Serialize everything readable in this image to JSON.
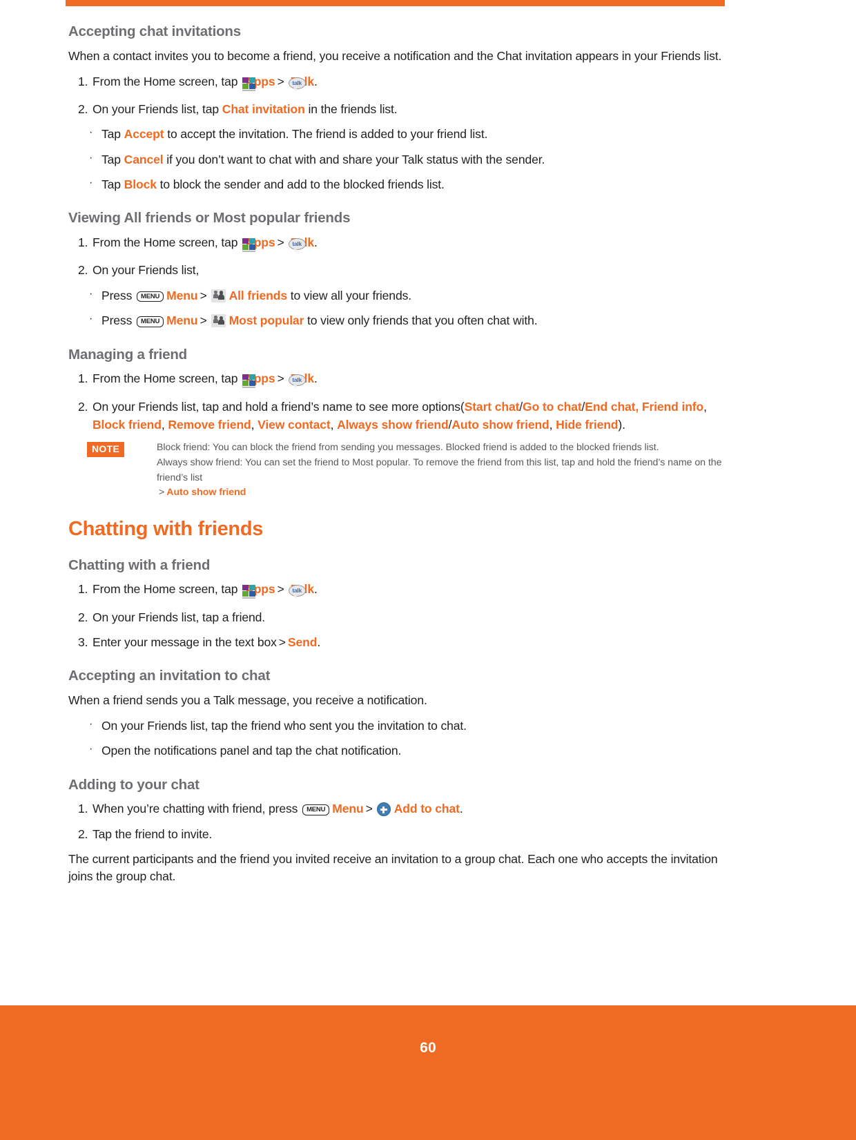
{
  "page": {
    "number": "60",
    "accent_color": "#ef6a22",
    "heading_gray": "#6d6e71",
    "body_black": "#231f20"
  },
  "icons": {
    "apps": "apps-grid-icon",
    "talk": "talk-bubble-icon",
    "talk_label": "talk",
    "menu": "menu-key-icon",
    "menu_label": "MENU",
    "friends": "friends-people-icon",
    "add": "add-to-chat-icon"
  },
  "sections": {
    "accepting_chat_invitations": {
      "title": "Accepting chat invitations",
      "intro": "When a contact invites you to become a friend, you receive a notification and the Chat invitation appears in your Friends list.",
      "step1": {
        "num": "1.",
        "pre": "From the Home screen, tap",
        "apps": "Apps",
        "sep": ">",
        "talk": "Talk",
        "end": "."
      },
      "step2": {
        "num": "2.",
        "pre": "On your Friends list, tap",
        "link": "Chat invitation",
        "post": "in the friends list."
      },
      "bullets": [
        {
          "pre": "Tap",
          "link": "Accept",
          "post": "to accept the invitation. The friend is added to your friend list."
        },
        {
          "pre": "Tap",
          "link": "Cancel",
          "post": "if you don’t want to chat with and share your Talk status with the sender."
        },
        {
          "pre": "Tap",
          "link": "Block",
          "post": "to block the sender and add to the blocked friends list."
        }
      ]
    },
    "viewing_friends": {
      "title": "Viewing All friends or Most popular friends",
      "step1": {
        "num": "1.",
        "pre": "From the Home screen, tap",
        "apps": "Apps",
        "sep": ">",
        "talk": "Talk",
        "end": "."
      },
      "step2": {
        "num": "2.",
        "text": "On your Friends list,"
      },
      "bullets": [
        {
          "pre": "Press",
          "menu": "Menu",
          "sep": ">",
          "link": "All friends",
          "post": "to view all your friends."
        },
        {
          "pre": "Press",
          "menu": "Menu",
          "sep": ">",
          "link": "Most popular",
          "post": "to view only friends that you often chat with."
        }
      ]
    },
    "managing_a_friend": {
      "title": "Managing a friend",
      "step1": {
        "num": "1.",
        "pre": "From the Home screen, tap",
        "apps": "Apps",
        "sep": ">",
        "talk": "Talk",
        "end": "."
      },
      "step2": {
        "num": "2.",
        "pre": "On your Friends list, tap and hold a friend’s name to see more options(",
        "options_line1": [
          "Start chat",
          "Go to chat",
          "End chat, Friend info"
        ],
        "options_line2": [
          "Block friend",
          "Remove friend",
          "View contact",
          "Always show friend",
          "Auto show friend",
          "Hide friend"
        ],
        "close": ")."
      },
      "note": {
        "badge": "NOTE",
        "line1": "Block friend: You can block the friend from sending you messages. Blocked friend is added to the blocked friends list.",
        "line2": "Always show friend: You can set the friend to Most popular. To remove the friend from this list, tap and hold the friend’s name on the friend’s list",
        "line3_sep": ">",
        "line3_link": "Auto show friend"
      }
    },
    "chatting_with_friends": {
      "title": "Chatting with friends",
      "chatting_with_a_friend": {
        "title": "Chatting with a friend",
        "step1": {
          "num": "1.",
          "pre": "From the Home screen, tap",
          "apps": "Apps",
          "sep": ">",
          "talk": "Talk",
          "end": "."
        },
        "step2": {
          "num": "2.",
          "text": "On your Friends list, tap a friend."
        },
        "step3": {
          "num": "3.",
          "pre": "Enter your message in the text box",
          "sep": ">",
          "link": "Send",
          "end": "."
        }
      },
      "accepting_invitation": {
        "title": "Accepting an invitation to chat",
        "intro": "When a friend sends you a Talk message, you receive a notification.",
        "bullets": [
          "On your Friends list, tap the friend who sent you the invitation to chat.",
          "Open the notifications panel and tap the chat notification."
        ]
      },
      "adding_to_chat": {
        "title": "Adding to your chat",
        "step1": {
          "num": "1.",
          "pre": "When you’re chatting with friend, press",
          "menu": "Menu",
          "sep": ">",
          "link": "Add to chat",
          "end": "."
        },
        "step2": {
          "num": "2.",
          "text": "Tap the friend to invite."
        },
        "closing": "The current participants and the friend you invited receive an invitation to a group chat. Each one who accepts the invitation joins the group chat."
      }
    }
  }
}
